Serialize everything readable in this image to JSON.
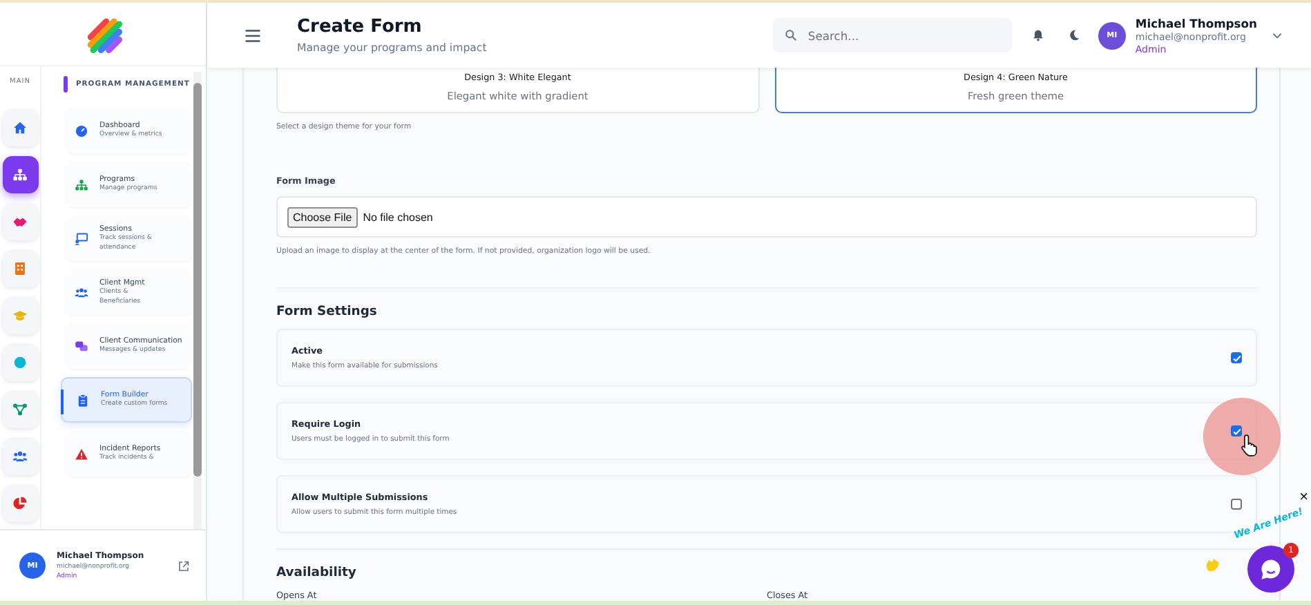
{
  "rail": {
    "label": "MAIN",
    "items": [
      {
        "kind": "home",
        "selected": false
      },
      {
        "kind": "sitemap",
        "selected": true
      },
      {
        "kind": "handshake",
        "selected": false
      },
      {
        "kind": "building",
        "selected": false
      },
      {
        "kind": "cap",
        "selected": false
      },
      {
        "kind": "dot",
        "selected": false
      },
      {
        "kind": "network",
        "selected": false
      },
      {
        "kind": "users",
        "selected": false
      },
      {
        "kind": "pie",
        "selected": false
      }
    ]
  },
  "sidebar": {
    "section": "PROGRAM MANAGEMENT",
    "items": [
      {
        "kind": "gauge",
        "title": "Dashboard",
        "subtitle": "Overview & metrics",
        "selected": false
      },
      {
        "kind": "sitemap",
        "title": "Programs",
        "subtitle": "Manage programs",
        "selected": false
      },
      {
        "kind": "screen",
        "title": "Sessions",
        "subtitle": "Track sessions & attendance",
        "selected": false
      },
      {
        "kind": "users",
        "title": "Client Mgmt",
        "subtitle": "Clients & Beneficiaries",
        "selected": false
      },
      {
        "kind": "chat",
        "title": "Client Communication",
        "subtitle": "Messages & updates",
        "selected": false
      },
      {
        "kind": "clipboard",
        "title": "Form Builder",
        "subtitle": "Create custom forms",
        "selected": true
      },
      {
        "kind": "warning",
        "title": "Incident Reports",
        "subtitle": "Track incidents &",
        "selected": false
      }
    ]
  },
  "sidebar_user": {
    "initials": "MI",
    "name": "Michael Thompson",
    "email": "michael@nonprofit.org",
    "role": "Admin"
  },
  "header": {
    "title": "Create Form",
    "subtitle": "Manage your programs and impact",
    "search": {
      "placeholder": "Search..."
    },
    "user": {
      "initials": "MI",
      "name": "Michael Thompson",
      "email": "michael@nonprofit.org",
      "role": "Admin"
    }
  },
  "designs": {
    "options": [
      {
        "title": "Design 3: White Elegant",
        "description": "Elegant white with gradient",
        "selected": false
      },
      {
        "title": "Design 4: Green Nature",
        "description": "Fresh green theme",
        "selected": true
      }
    ],
    "hint": "Select a design theme for your form"
  },
  "form_image": {
    "label": "Form Image",
    "button": "Choose File",
    "status": "No file chosen",
    "hint": "Upload an image to display at the center of the form. If not provided, organization logo will be used."
  },
  "settings": {
    "heading": "Form Settings",
    "items": [
      {
        "title": "Active",
        "description": "Make this form available for submissions",
        "checked": true
      },
      {
        "title": "Require Login",
        "description": "Users must be logged in to submit this form",
        "checked": true
      },
      {
        "title": "Allow Multiple Submissions",
        "description": "Allow users to submit this form multiple times",
        "checked": false
      }
    ]
  },
  "availability": {
    "heading": "Availability",
    "fields": [
      "Opens At",
      "Closes At"
    ]
  },
  "chat_widget": {
    "caption": "We Are Here!",
    "badge": "1",
    "close": "×"
  }
}
